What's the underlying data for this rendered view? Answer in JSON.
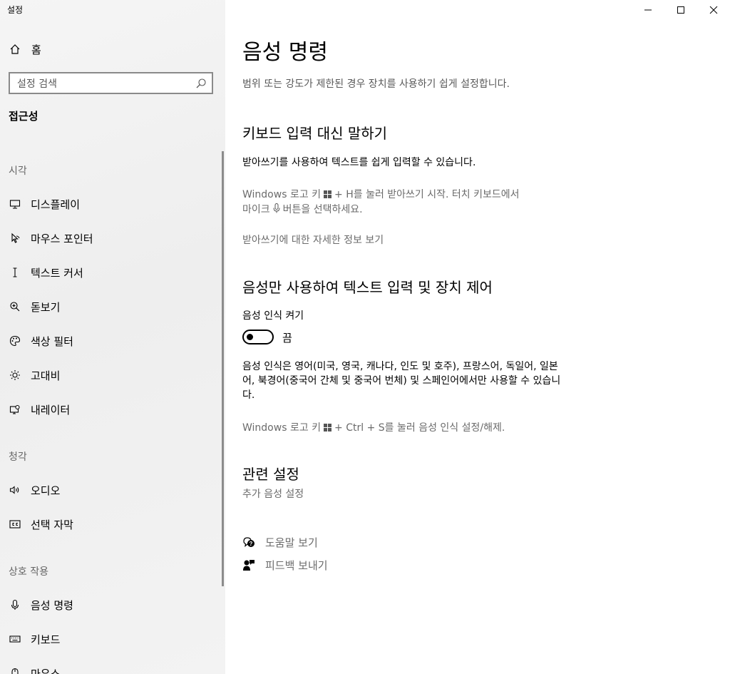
{
  "window": {
    "title": "설정",
    "minimize_icon": "minimize-icon",
    "maximize_icon": "maximize-icon",
    "close_icon": "close-icon"
  },
  "sidebar": {
    "home_label": "홈",
    "search_placeholder": "설정 검색",
    "section_title": "접근성",
    "groups": [
      {
        "label": "시각",
        "items": [
          {
            "label": "디스플레이",
            "icon": "display-icon"
          },
          {
            "label": "마우스 포인터",
            "icon": "mouse-pointer-icon"
          },
          {
            "label": "텍스트 커서",
            "icon": "text-cursor-icon"
          },
          {
            "label": "돋보기",
            "icon": "magnifier-icon"
          },
          {
            "label": "색상 필터",
            "icon": "color-filter-icon"
          },
          {
            "label": "고대비",
            "icon": "high-contrast-icon"
          },
          {
            "label": "내레이터",
            "icon": "narrator-icon"
          }
        ]
      },
      {
        "label": "청각",
        "items": [
          {
            "label": "오디오",
            "icon": "audio-icon"
          },
          {
            "label": "선택 자막",
            "icon": "closed-caption-icon"
          }
        ]
      },
      {
        "label": "상호 작용",
        "items": [
          {
            "label": "음성 명령",
            "icon": "microphone-icon"
          },
          {
            "label": "키보드",
            "icon": "keyboard-icon"
          },
          {
            "label": "마우스",
            "icon": "mouse-icon"
          }
        ]
      }
    ]
  },
  "main": {
    "title": "음성 명령",
    "subtitle": "범위 또는 강도가 제한된 경우 장치를 사용하기 쉽게 설정합니다.",
    "dictation": {
      "heading": "키보드 입력 대신 말하기",
      "desc": "받아쓰기를 사용하여 텍스트를 쉽게 입력할 수 있습니다.",
      "hint_part1": "Windows 로고 키",
      "hint_part2": "+ H를 눌러 받아쓰기 시작.  터치 키보드에서",
      "hint_part3": "마이크",
      "hint_part4": "버튼을 선택하세요.",
      "link": "받아쓰기에 대한 자세한 정보 보기"
    },
    "speech": {
      "heading": "음성만 사용하여 텍스트 입력 및 장치 제어",
      "toggle_title": "음성 인식 켜기",
      "toggle_state": "끔",
      "desc": "음성 인식은 영어(미국, 영국, 캐나다, 인도 및 호주), 프랑스어, 독일어, 일본어, 북경어(중국어 간체 및 중국어 번체) 및 스페인어에서만 사용할 수 있습니다.",
      "hint_part1": "Windows 로고 키",
      "hint_part2": "+ Ctrl + S를 눌러 음성 인식 설정/해제."
    },
    "related": {
      "heading": "관련 설정",
      "link": "추가 음성 설정"
    },
    "help": {
      "help_label": "도움말 보기",
      "feedback_label": "피드백 보내기"
    }
  }
}
